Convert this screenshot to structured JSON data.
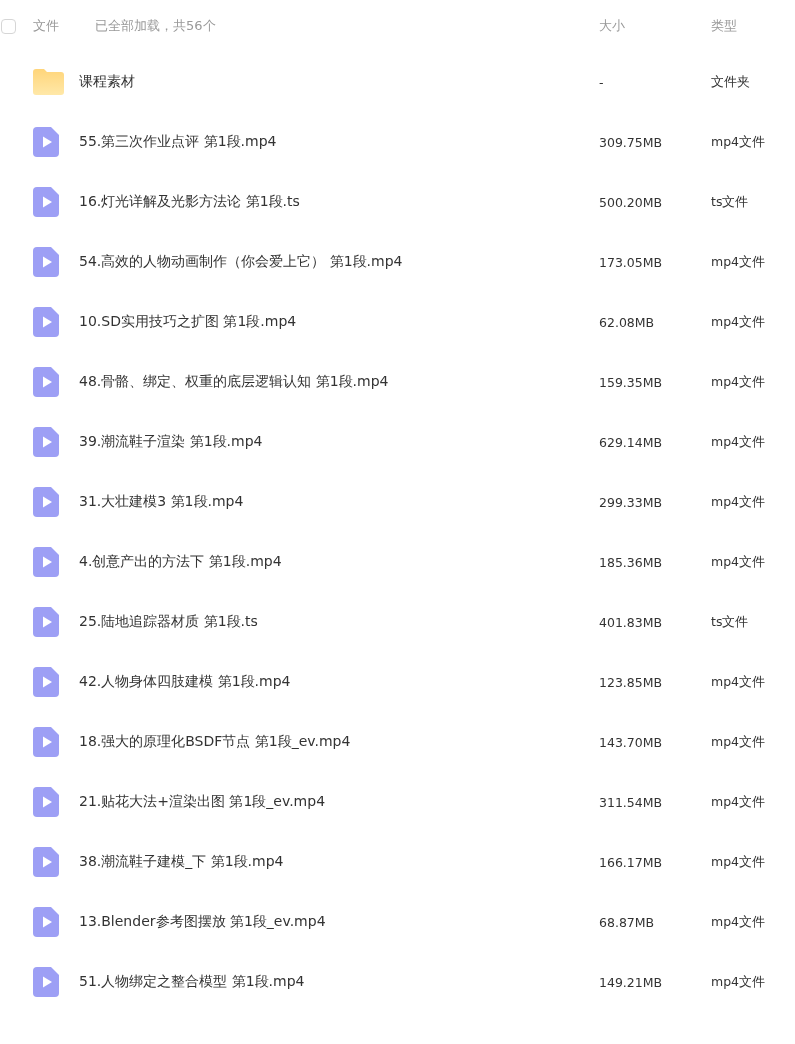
{
  "header": {
    "select_all": {
      "checked": false
    },
    "name_label": "文件",
    "status": "已全部加载，共56个",
    "size_label": "大小",
    "type_label": "类型"
  },
  "files": [
    {
      "kind": "folder",
      "name": "课程素材",
      "size": "-",
      "type": "文件夹"
    },
    {
      "kind": "video",
      "name": "55.第三次作业点评 第1段.mp4",
      "size": "309.75MB",
      "type": "mp4文件"
    },
    {
      "kind": "video",
      "name": "16.灯光详解及光影方法论 第1段.ts",
      "size": "500.20MB",
      "type": "ts文件"
    },
    {
      "kind": "video",
      "name": "54.高效的人物动画制作（你会爱上它） 第1段.mp4",
      "size": "173.05MB",
      "type": "mp4文件"
    },
    {
      "kind": "video",
      "name": "10.SD实用技巧之扩图 第1段.mp4",
      "size": "62.08MB",
      "type": "mp4文件"
    },
    {
      "kind": "video",
      "name": "48.骨骼、绑定、权重的底层逻辑认知 第1段.mp4",
      "size": "159.35MB",
      "type": "mp4文件"
    },
    {
      "kind": "video",
      "name": "39.潮流鞋子渲染 第1段.mp4",
      "size": "629.14MB",
      "type": "mp4文件"
    },
    {
      "kind": "video",
      "name": "31.大壮建模3 第1段.mp4",
      "size": "299.33MB",
      "type": "mp4文件"
    },
    {
      "kind": "video",
      "name": "4.创意产出的方法下 第1段.mp4",
      "size": "185.36MB",
      "type": "mp4文件"
    },
    {
      "kind": "video",
      "name": "25.陆地追踪器材质 第1段.ts",
      "size": "401.83MB",
      "type": "ts文件"
    },
    {
      "kind": "video",
      "name": "42.人物身体四肢建模 第1段.mp4",
      "size": "123.85MB",
      "type": "mp4文件"
    },
    {
      "kind": "video",
      "name": "18.强大的原理化BSDF节点 第1段_ev.mp4",
      "size": "143.70MB",
      "type": "mp4文件"
    },
    {
      "kind": "video",
      "name": "21.贴花大法+渲染出图 第1段_ev.mp4",
      "size": "311.54MB",
      "type": "mp4文件"
    },
    {
      "kind": "video",
      "name": "38.潮流鞋子建模_下 第1段.mp4",
      "size": "166.17MB",
      "type": "mp4文件"
    },
    {
      "kind": "video",
      "name": "13.Blender参考图摆放 第1段_ev.mp4",
      "size": "68.87MB",
      "type": "mp4文件"
    },
    {
      "kind": "video",
      "name": "51.人物绑定之整合模型 第1段.mp4",
      "size": "149.21MB",
      "type": "mp4文件"
    }
  ]
}
